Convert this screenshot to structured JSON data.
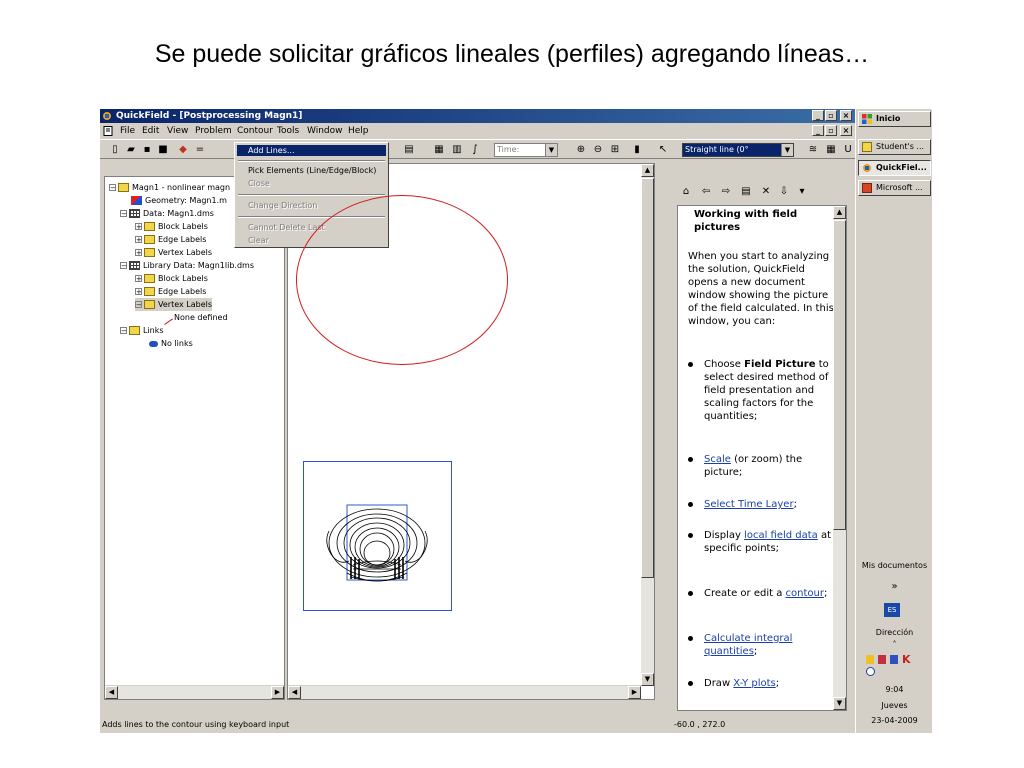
{
  "slide_title": "Se puede solicitar gráficos lineales (perfiles) agregando líneas…",
  "window": {
    "title": "QuickField - [Postprocessing Magn1]",
    "menu": [
      "File",
      "Edit",
      "View",
      "Problem",
      "Contour",
      "Tools",
      "Window",
      "Help"
    ],
    "toolbar_time_label": "Time:",
    "toolbar_line_combo": "Straight line (0°"
  },
  "contour_menu": {
    "items": [
      {
        "label": "Add Lines...",
        "enabled": true,
        "selected": true
      },
      {
        "label": "Pick Elements (Line/Edge/Block)",
        "enabled": true
      },
      {
        "label": "Close",
        "enabled": false
      },
      {
        "label": "Change Direction",
        "enabled": false
      },
      {
        "label": "Cannot Delete Last",
        "enabled": false
      },
      {
        "label": "Clear",
        "enabled": false
      }
    ]
  },
  "tree": {
    "items": [
      {
        "label": "Magn1 - nonlinear magn",
        "icon": "folder-open-icon"
      },
      {
        "label": "Geometry: Magn1.m",
        "icon": "geometry-icon"
      },
      {
        "label": "Data: Magn1.dms",
        "icon": "table-icon"
      },
      {
        "label": "Block Labels",
        "icon": "folder-icon"
      },
      {
        "label": "Edge Labels",
        "icon": "folder-icon"
      },
      {
        "label": "Vertex Labels",
        "icon": "folder-icon"
      },
      {
        "label": "Library Data: Magn1lib.dms",
        "icon": "table-icon"
      },
      {
        "label": "Block Labels",
        "icon": "folder-icon"
      },
      {
        "label": "Edge Labels",
        "icon": "folder-icon"
      },
      {
        "label": "Vertex Labels",
        "icon": "folder-open-icon"
      },
      {
        "label": "None defined",
        "icon": "pencil-icon"
      },
      {
        "label": "Links",
        "icon": "folder-open-icon"
      },
      {
        "label": "No links",
        "icon": "link-icon"
      }
    ]
  },
  "help": {
    "heading": "Working with field pictures",
    "intro": "When you start to analyzing the solution, QuickField opens a new document window showing the picture of the field calculated. In this window, you can:",
    "b1_pre": "Choose ",
    "b1_bold": "Field Picture",
    "b1_post": " to select desired method of field presentation and scaling factors for the quantities;",
    "b2_link": "Scale",
    "b2_post": " (or zoom) the picture;",
    "b3_link": "Select Time Layer",
    "b3_post": ";",
    "b4_pre": "Display ",
    "b4_link": "local field data",
    "b4_post": " at specific points;",
    "b5_pre": "Create or edit a ",
    "b5_link": "contour",
    "b5_post": ";",
    "b6_link": "Calculate integral quantities",
    "b6_post": ";",
    "b7_pre": "Draw ",
    "b7_link": "X-Y plots",
    "b7_post": ";"
  },
  "status": {
    "left": "Adds lines to the contour using keyboard input",
    "coords": "-60.0 , 272.0"
  },
  "taskbar": {
    "start": "Inicio",
    "buttons": [
      "Student's ...",
      "QuickFiel...",
      "Microsoft ..."
    ],
    "mis_documentos": "Mis documentos",
    "chevron": "»",
    "direccion": "Dirección",
    "time": "9:04",
    "day": "Jueves",
    "date": "23-04-2009"
  },
  "colors": {
    "titlebar": "#0a246a",
    "annotation_circle": "#d21d1d",
    "link": "#1a3faa"
  }
}
